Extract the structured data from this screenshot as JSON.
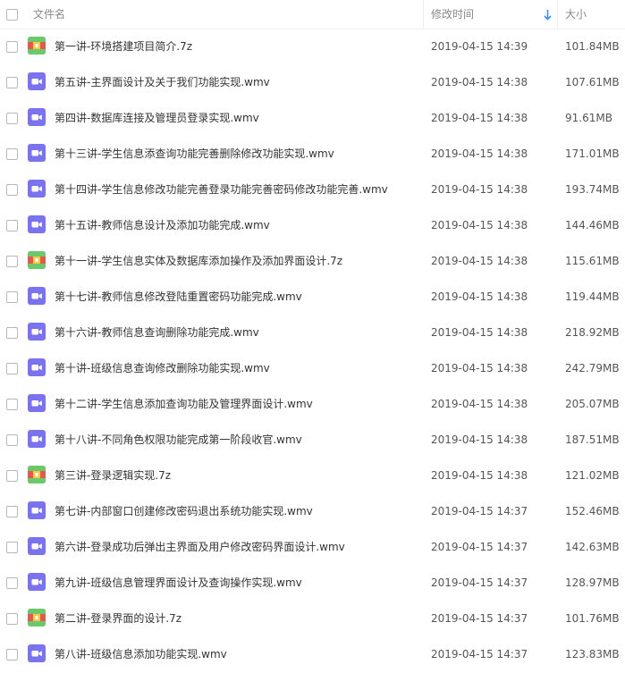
{
  "header": {
    "name_label": "文件名",
    "time_label": "修改时间",
    "size_label": "大小"
  },
  "colors": {
    "video_icon": "#7b72f0",
    "archive_icon_red": "#e4584f",
    "archive_icon_green": "#6cc96b",
    "sort_arrow": "#3f8cff"
  },
  "files": [
    {
      "name": "第一讲-环境搭建项目简介.7z",
      "time": "2019-04-15 14:39",
      "size": "101.84MB",
      "icon": "archive-icon"
    },
    {
      "name": "第五讲-主界面设计及关于我们功能实现.wmv",
      "time": "2019-04-15 14:38",
      "size": "107.61MB",
      "icon": "video-icon"
    },
    {
      "name": "第四讲-数据库连接及管理员登录实现.wmv",
      "time": "2019-04-15 14:38",
      "size": "91.61MB",
      "icon": "video-icon"
    },
    {
      "name": "第十三讲-学生信息添查询功能完善删除修改功能实现.wmv",
      "time": "2019-04-15 14:38",
      "size": "171.01MB",
      "icon": "video-icon"
    },
    {
      "name": "第十四讲-学生信息修改功能完善登录功能完善密码修改功能完善.wmv",
      "time": "2019-04-15 14:38",
      "size": "193.74MB",
      "icon": "video-icon"
    },
    {
      "name": "第十五讲-教师信息设计及添加功能完成.wmv",
      "time": "2019-04-15 14:38",
      "size": "144.46MB",
      "icon": "video-icon"
    },
    {
      "name": "第十一讲-学生信息实体及数据库添加操作及添加界面设计.7z",
      "time": "2019-04-15 14:38",
      "size": "115.61MB",
      "icon": "archive-icon"
    },
    {
      "name": "第十七讲-教师信息修改登陆重置密码功能完成.wmv",
      "time": "2019-04-15 14:38",
      "size": "119.44MB",
      "icon": "video-icon"
    },
    {
      "name": "第十六讲-教师信息查询删除功能完成.wmv",
      "time": "2019-04-15 14:38",
      "size": "218.92MB",
      "icon": "video-icon"
    },
    {
      "name": "第十讲-班级信息查询修改删除功能实现.wmv",
      "time": "2019-04-15 14:38",
      "size": "242.79MB",
      "icon": "video-icon"
    },
    {
      "name": "第十二讲-学生信息添加查询功能及管理界面设计.wmv",
      "time": "2019-04-15 14:38",
      "size": "205.07MB",
      "icon": "video-icon"
    },
    {
      "name": "第十八讲-不同角色权限功能完成第一阶段收官.wmv",
      "time": "2019-04-15 14:38",
      "size": "187.51MB",
      "icon": "video-icon"
    },
    {
      "name": "第三讲-登录逻辑实现.7z",
      "time": "2019-04-15 14:38",
      "size": "121.02MB",
      "icon": "archive-icon"
    },
    {
      "name": "第七讲-内部窗口创建修改密码退出系统功能实现.wmv",
      "time": "2019-04-15 14:37",
      "size": "152.46MB",
      "icon": "video-icon"
    },
    {
      "name": "第六讲-登录成功后弹出主界面及用户修改密码界面设计.wmv",
      "time": "2019-04-15 14:37",
      "size": "142.63MB",
      "icon": "video-icon"
    },
    {
      "name": "第九讲-班级信息管理界面设计及查询操作实现.wmv",
      "time": "2019-04-15 14:37",
      "size": "128.97MB",
      "icon": "video-icon"
    },
    {
      "name": "第二讲-登录界面的设计.7z",
      "time": "2019-04-15 14:37",
      "size": "101.76MB",
      "icon": "archive-icon"
    },
    {
      "name": "第八讲-班级信息添加功能实现.wmv",
      "time": "2019-04-15 14:37",
      "size": "123.83MB",
      "icon": "video-icon"
    }
  ]
}
